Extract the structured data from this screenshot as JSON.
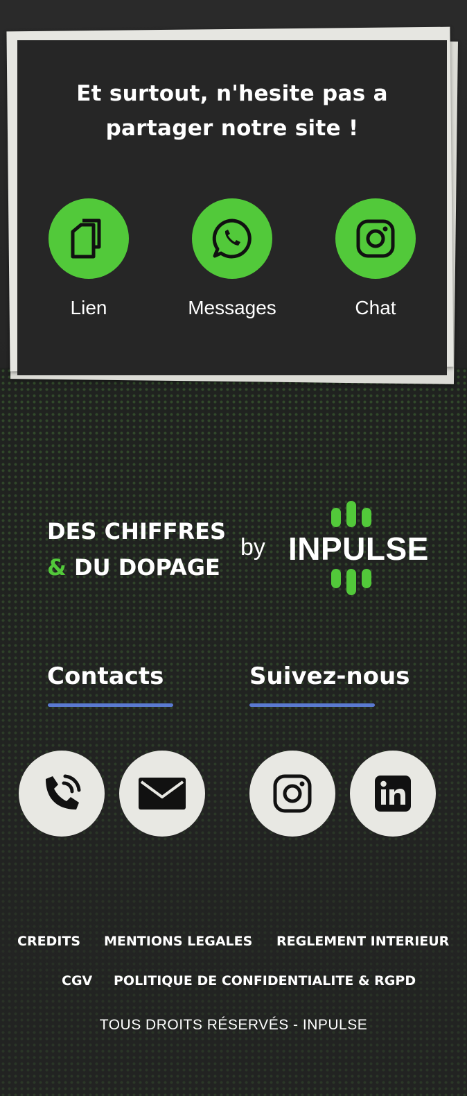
{
  "share": {
    "title_line1": "Et surtout, n'hesite pas a",
    "title_line2": "partager notre site !",
    "buttons": [
      {
        "label": "Lien",
        "icon": "copy-link-icon"
      },
      {
        "label": "Messages",
        "icon": "whatsapp-icon"
      },
      {
        "label": "Chat",
        "icon": "instagram-icon"
      }
    ]
  },
  "brand": {
    "line1": "DES CHIFFRES",
    "amp": "&",
    "line2": "DU DOPAGE",
    "by": "by",
    "logo_text": "INPULSE"
  },
  "contacts": {
    "title": "Contacts",
    "icons": [
      "phone-icon",
      "mail-icon"
    ]
  },
  "follow": {
    "title": "Suivez-nous",
    "icons": [
      "instagram-icon",
      "linkedin-icon"
    ]
  },
  "footer": {
    "links_row1": [
      "CREDITS",
      "MENTIONS LEGALES",
      "REGLEMENT INTERIEUR"
    ],
    "links_row2": [
      "CGV",
      "POLITIQUE DE CONFIDENTIALITE & RGPD"
    ],
    "copyright": "TOUS DROITS RÉSERVÉS - INPULSE"
  },
  "colors": {
    "accent": "#52c93a",
    "underline": "#5a7ad0",
    "card": "#262626",
    "paper": "#e6e6e1"
  }
}
